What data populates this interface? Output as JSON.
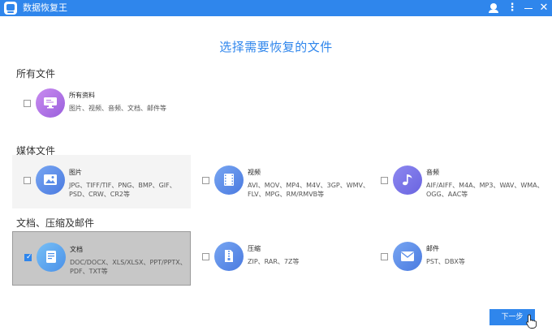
{
  "app": {
    "title": "数据恢复王",
    "menu_glyph": "⋮",
    "close_glyph": "✕"
  },
  "page_title": "选择需要恢复的文件",
  "sections": {
    "all": "所有文件",
    "media": "媒体文件",
    "docs": "文档、压缩及邮件"
  },
  "cards": {
    "all_data": {
      "name": "所有资料",
      "desc": "图片、视频、音频、文档、邮件等",
      "checked": false,
      "icon": "monitor-icon",
      "color": "#b476e0"
    },
    "pictures": {
      "name": "图片",
      "desc": "JPG、TIFF/TIF、PNG、BMP、GIF、PSD、CRW、CR2等",
      "checked": false,
      "icon": "picture-icon",
      "color": "#5a8de8"
    },
    "video": {
      "name": "视频",
      "desc": "AVI、MOV、MP4、M4V、3GP、WMV、FLV、MPG、RM/RMVB等",
      "checked": false,
      "icon": "film-icon",
      "color": "#5a8de8"
    },
    "audio": {
      "name": "音频",
      "desc": "AIF/AIFF、M4A、MP3、WAV、WMA、OGG、AAC等",
      "checked": false,
      "icon": "music-note-icon",
      "color": "#7a74e8"
    },
    "documents": {
      "name": "文档",
      "desc": "DOC/DOCX、XLS/XLSX、PPT/PPTX、PDF、TXT等",
      "checked": true,
      "icon": "document-icon",
      "color": "#5aa6f0"
    },
    "archive": {
      "name": "压缩",
      "desc": "ZIP、RAR、7Z等",
      "checked": false,
      "icon": "zip-file-icon",
      "color": "#5a8de8"
    },
    "email": {
      "name": "邮件",
      "desc": "PST、DBX等",
      "checked": false,
      "icon": "envelope-icon",
      "color": "#5a8de8"
    }
  },
  "buttons": {
    "next": "下一步"
  },
  "colors": {
    "accent": "#2f86ec",
    "selected_bg": "#c7c7c7"
  }
}
